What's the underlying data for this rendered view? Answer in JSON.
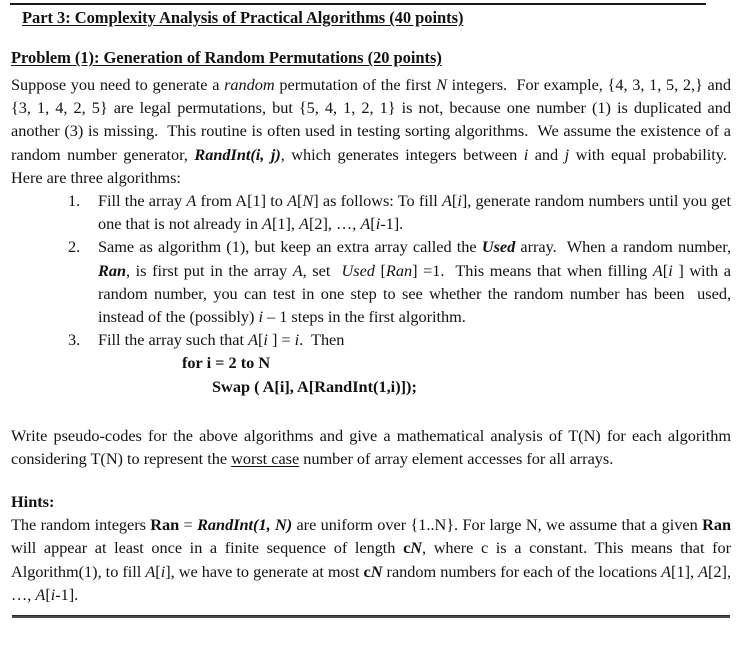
{
  "document": {
    "part_title": "Part 3: Complexity Analysis of Practical Algorithms (40 points)",
    "problem_title": "Problem (1): Generation of Random Permutations (20 points)",
    "intro_paragraph": "Suppose you need to generate a random permutation of the first N integers.  For example, {4, 3, 1, 5, 2,} and {3, 1, 4, 2, 5} are legal permutations, but {5, 4, 1, 2, 1} is not, because one number (1) is duplicated and another (3) is missing.  This routine is often used in testing sorting algorithms.  We assume the existence of a random number generator, RandInt(i, j), which generates integers between i and j with equal probability.  Here are three algorithms:",
    "algorithms": [
      {
        "number": "1.",
        "text": "Fill the array A from A[1] to A[N] as follows: To fill A[i], generate random numbers until you get one that is not already in A[1], A[2], …, A[i-1]."
      },
      {
        "number": "2.",
        "text": "Same as algorithm (1), but keep an extra array called the Used array.  When a random number, Ran, is first put in the array A, set  Used [Ran] =1.  This means that when filling A[i ] with a random number, you can test in one step to see whether the random number has been  used, instead of the (possibly) i – 1 steps in the first algorithm."
      },
      {
        "number": "3.",
        "text": "Fill the array such that A[i ] = i.  Then",
        "code_for": "for i = 2 to N",
        "code_swap": "Swap ( A[i], A[RandInt(1,i)]);"
      }
    ],
    "task_paragraph": "Write pseudo-codes for the above algorithms and give a mathematical analysis of T(N) for each algorithm considering T(N) to represent the worst case number of array element accesses for all arrays.",
    "hints_title": "Hints:",
    "hints_paragraph": "The random integers Ran = RandInt(1, N) are uniform over {1..N}. For large N, we assume that a given Ran will appear at least once in a finite sequence of length cN, where c is a constant. This means that for Algorithm(1), to fill A[i], we have to generate at most cN random numbers for each of the locations A[1], A[2], …, A[i-1]."
  },
  "style": {
    "ink_color": "#121212",
    "rule_color": "#1a1a1a",
    "page_background": "#ffffff"
  }
}
